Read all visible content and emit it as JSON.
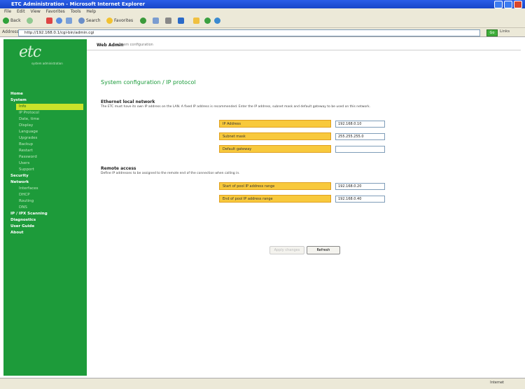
{
  "window": {
    "title": "ETC Administration - Microsoft Internet Explorer"
  },
  "menu": [
    "File",
    "Edit",
    "View",
    "Favorites",
    "Tools",
    "Help"
  ],
  "toolbar": {
    "back": "Back",
    "search": "Search",
    "favorites": "Favorites"
  },
  "address": {
    "label": "Address",
    "url": "http://192.168.0.1/cgi-bin/admin.cgi",
    "go": "Go",
    "links": "Links"
  },
  "brand": {
    "logo": "etc",
    "tagline": "system administration"
  },
  "header": {
    "title": "Web Admin",
    "subtitle": "system configuration"
  },
  "nav": {
    "home": "Home",
    "system": "System",
    "system_items": [
      "Info",
      "IP Protocol",
      "Date, time",
      "Display",
      "Language",
      "Upgrades",
      "Backup",
      "Restart",
      "Password",
      "Users",
      "Support"
    ],
    "security": "Security",
    "network": "Network",
    "network_items": [
      "Interfaces",
      "DHCP",
      "Routing",
      "DNS"
    ],
    "ip_ipx": "IP / IPX Scanning",
    "diagnostics": "Diagnostics",
    "user_guide": "User Guide",
    "about": "About"
  },
  "page": {
    "title": "System configuration / IP protocol"
  },
  "ethernet": {
    "title": "Ethernet local network",
    "text": "The ETC must have its own IP address on the LAN. A fixed IP address is recommended. Enter the IP address, subnet mask and default gateway to be used on this network.",
    "fields": [
      {
        "label": "IP Address",
        "value": "192.168.0.10"
      },
      {
        "label": "Subnet mask",
        "value": "255.255.255.0"
      },
      {
        "label": "Default gateway",
        "value": ""
      }
    ]
  },
  "remote": {
    "title": "Remote access",
    "text": "Define IP addresses to be assigned to the remote end of the connection when calling in.",
    "fields": [
      {
        "label": "Start of pool IP address range",
        "value": "192.168.0.20"
      },
      {
        "label": "End of pool IP address range",
        "value": "192.168.0.40"
      }
    ]
  },
  "buttons": {
    "apply": "Apply changes",
    "refresh": "Refresh"
  },
  "status": {
    "zone": "Internet"
  },
  "colors": {
    "sidebar": "#1d9b3a",
    "field_label": "#f8c93c",
    "accent": "#1a9b3a"
  }
}
